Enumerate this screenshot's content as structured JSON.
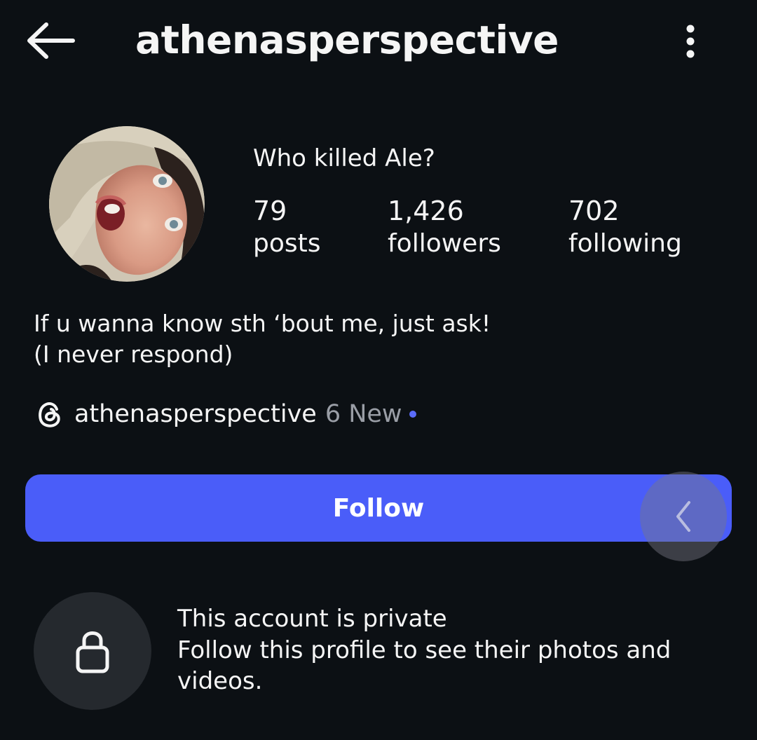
{
  "header": {
    "username": "athenasperspective",
    "back_icon": "arrow-left-icon",
    "menu_icon": "vertical-dots-icon"
  },
  "profile": {
    "display_name": "Who killed Ale?",
    "stats": {
      "posts": {
        "value": "79",
        "label": "posts"
      },
      "followers": {
        "value": "1,426",
        "label": "followers"
      },
      "following": {
        "value": "702",
        "label": "following"
      }
    },
    "bio": {
      "line1": "If u wanna know sth ‘bout me, just ask!",
      "line2": "(I never respond)"
    },
    "threads": {
      "icon": "threads-icon",
      "handle": "athenasperspective",
      "new_label": "6 New"
    }
  },
  "actions": {
    "follow_label": "Follow",
    "edge_handle_icon": "chevron-left-icon"
  },
  "private_notice": {
    "icon": "lock-icon",
    "title": "This account is private",
    "description_line1": "Follow this profile to see their photos and",
    "description_line2": "videos."
  },
  "colors": {
    "background": "#0c1014",
    "accent": "#4a5df9",
    "muted_text": "#9a9ea6",
    "lock_circle": "#25292e"
  }
}
